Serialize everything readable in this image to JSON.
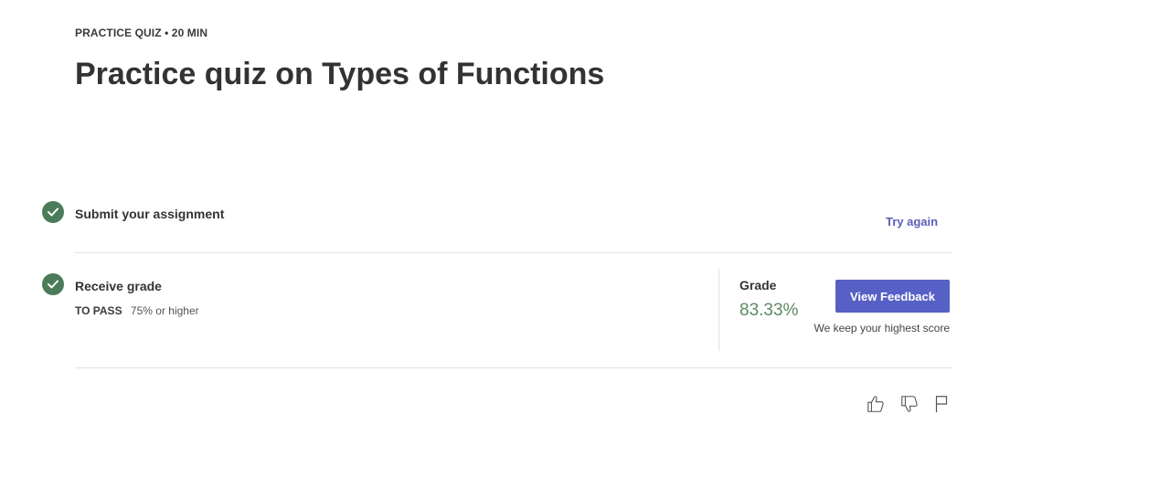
{
  "header": {
    "eyebrow": "PRACTICE QUIZ • 20 MIN",
    "title": "Practice quiz on Types of Functions"
  },
  "steps": {
    "submit": {
      "title": "Submit your assignment",
      "action_label": "Try again"
    },
    "receive": {
      "title": "Receive grade",
      "to_pass_label": "TO PASS",
      "to_pass_value": "75% or higher"
    }
  },
  "grade": {
    "label": "Grade",
    "value": "83.33%",
    "button_label": "View Feedback",
    "note": "We keep your highest score"
  },
  "feedback_icons": [
    "thumbs-up-icon",
    "thumbs-down-icon",
    "flag-icon"
  ],
  "colors": {
    "check_green": "#4a7c59",
    "grade_green": "#5c8a62",
    "primary_button": "#5760c4",
    "link": "#5b5fb8"
  }
}
